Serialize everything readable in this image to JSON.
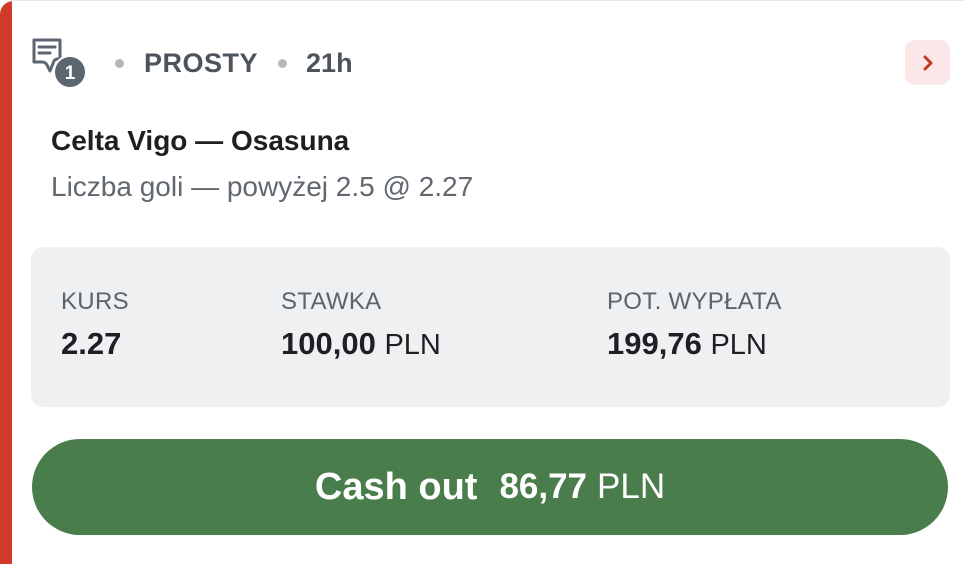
{
  "bet": {
    "count": "1",
    "type": "PROSTY",
    "time": "21h"
  },
  "event": {
    "match": "Celta Vigo — Osasuna",
    "selection": "Liczba goli — powyżej 2.5 @ 2.27"
  },
  "stats": {
    "odds_label": "KURS",
    "odds_value": "2.27",
    "stake_label": "STAWKA",
    "stake_value": "100,00",
    "stake_currency": "PLN",
    "payout_label": "POT. WYPŁATA",
    "payout_value": "199,76",
    "payout_currency": "PLN"
  },
  "cashout": {
    "label": "Cash out",
    "amount": "86,77",
    "currency": "PLN"
  },
  "icons": {
    "bet_slip": "bet-slip-icon",
    "expand": "chevron-right-icon"
  },
  "colors": {
    "accent_bar": "#d13a2b",
    "cashout_button": "#4a7d4c",
    "expand_button_bg": "#fbe7e7",
    "expand_chevron": "#c0392b",
    "stats_bg": "#eef0f2"
  }
}
